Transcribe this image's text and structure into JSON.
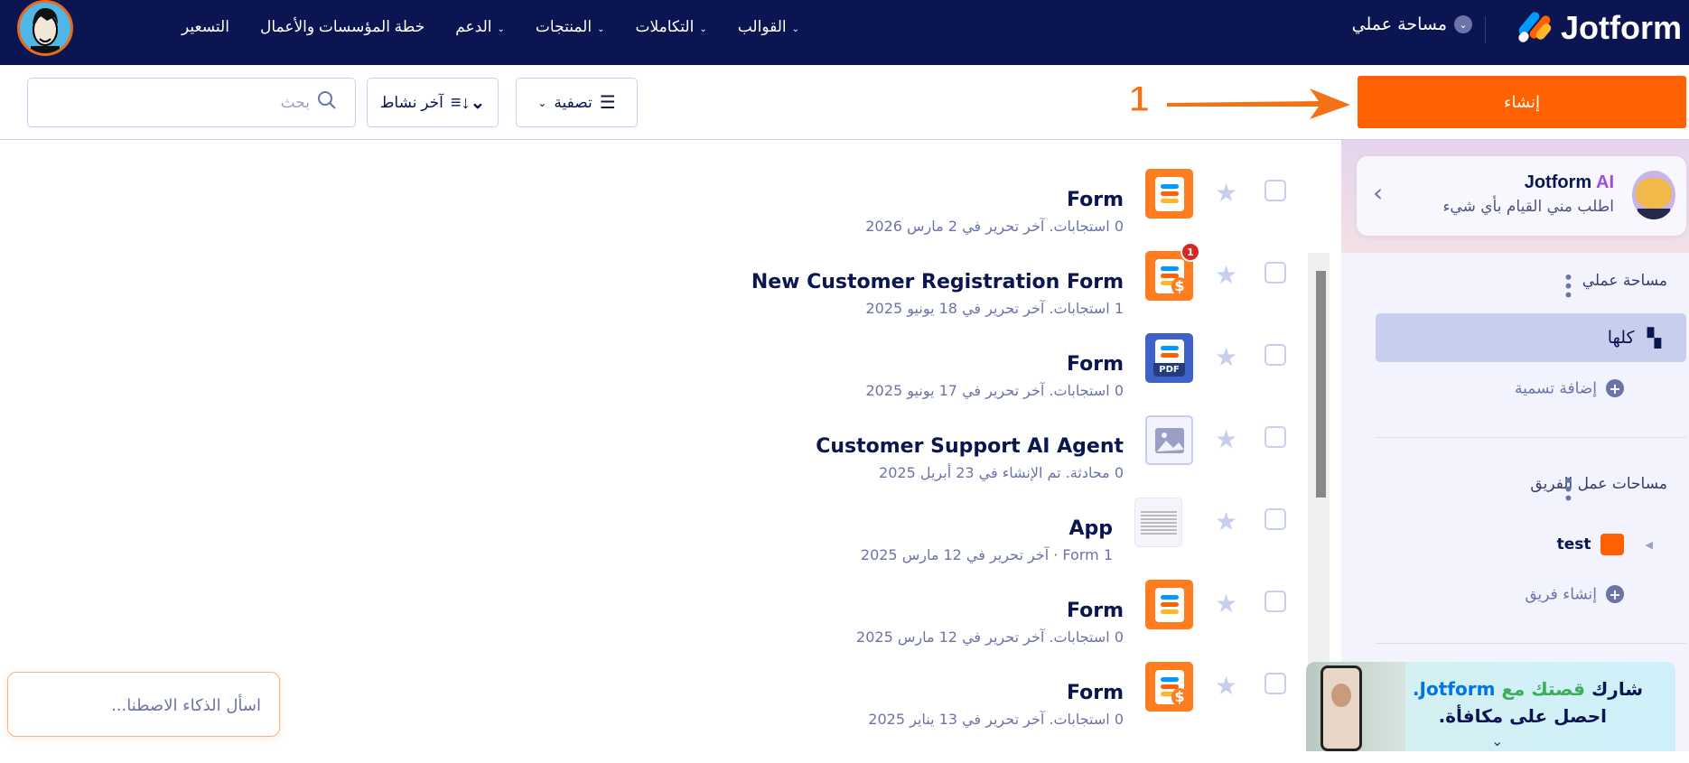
{
  "header": {
    "brand": "Jotform",
    "workspace_label": "مساحة عملي",
    "nav": [
      {
        "label": "القوالب",
        "dropdown": true
      },
      {
        "label": "التكاملات",
        "dropdown": true
      },
      {
        "label": "المنتجات",
        "dropdown": true
      },
      {
        "label": "الدعم",
        "dropdown": true
      },
      {
        "label": "خطة المؤسسات والأعمال",
        "dropdown": false
      },
      {
        "label": "التسعير",
        "dropdown": false
      }
    ]
  },
  "toolbar": {
    "create_label": "إنشاء",
    "annotation_number": "1",
    "filter_label": "تصفية",
    "sort_label": "آخر نشاط",
    "search_placeholder": "بحث"
  },
  "assets": [
    {
      "title": "Form",
      "subtitle": "0 استجابات. آخر تحرير في 2 مارس 2026",
      "icon": "form-icon"
    },
    {
      "title": "New Customer Registration Form",
      "subtitle": "1 استجابات. آخر تحرير في 18 يونيو 2025",
      "icon": "payment-form-icon",
      "badge": "1"
    },
    {
      "title": "Form",
      "subtitle": "0 استجابات. آخر تحرير في 17 يونيو 2025",
      "icon": "pdf-form-icon",
      "pdf_label": "PDF"
    },
    {
      "title": "Customer Support AI Agent",
      "subtitle": "0 محادثة. تم الإنشاء في 23 أبريل 2025",
      "icon": "image-placeholder-icon"
    },
    {
      "title": "App",
      "subtitle": "1 Form · آخر تحرير في 12 مارس 2025",
      "icon": "app-thumbnail"
    },
    {
      "title": "Form",
      "subtitle": "0 استجابات. آخر تحرير في 12 مارس 2025",
      "icon": "form-icon"
    },
    {
      "title": "Form",
      "subtitle": "0 استجابات. آخر تحرير في 13 يناير 2025",
      "icon": "payment-form-icon"
    }
  ],
  "sidebar": {
    "ai_title_a": "Jotform",
    "ai_title_b": "AI",
    "ai_subtitle": "اطلب مني القيام بأي شيء",
    "my_workspace": "مساحة عملي",
    "all_label": "كلها",
    "add_label": "إضافة تسمية",
    "team_workspaces": "مساحات عمل الفريق",
    "team_name": "test",
    "create_team": "إنشاء فريق"
  },
  "promo": {
    "line1_a": "شارك",
    "line1_b": "قصتك مع",
    "line1_c": "Jotform.",
    "line2": "احصل على مكافأة."
  },
  "ask_ai": {
    "placeholder": "اسأل الذكاء الاصطنا..."
  },
  "colors": {
    "navy": "#0a1551",
    "orange": "#ff6100",
    "muted": "#6c73a8",
    "border": "#c8ceed"
  }
}
